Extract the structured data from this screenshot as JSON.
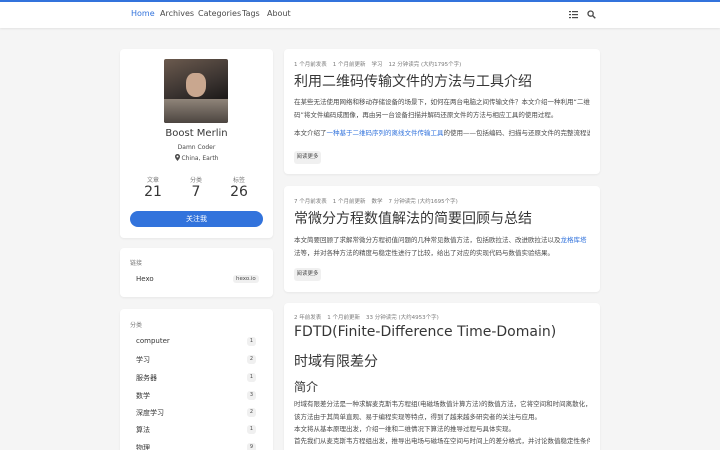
{
  "nav": {
    "items": [
      "Home",
      "Archives",
      "Categories",
      "Tags",
      "About"
    ],
    "icons": {
      "toc": "list-icon",
      "search": "search-icon"
    },
    "accent": "#3273dc"
  },
  "profile": {
    "name": "Boost Merlin",
    "tagline": "Damn Coder",
    "location": "China, Earth",
    "stats": [
      {
        "label": "文章",
        "value": "21"
      },
      {
        "label": "分类",
        "value": "7"
      },
      {
        "label": "标签",
        "value": "26"
      }
    ],
    "follow_label": "关注我"
  },
  "links": {
    "heading": "链接",
    "items": [
      {
        "name": "Hexo",
        "url_label": "hexo.io"
      }
    ]
  },
  "categories": {
    "heading": "分类",
    "items": [
      {
        "name": "computer",
        "count": "1"
      },
      {
        "name": "学习",
        "count": "2"
      },
      {
        "name": "服务器",
        "count": "1"
      },
      {
        "name": "数学",
        "count": "3"
      },
      {
        "name": "深度学习",
        "count": "2"
      },
      {
        "name": "算法",
        "count": "1"
      },
      {
        "name": "物理",
        "count": "9"
      }
    ]
  },
  "posts": [
    {
      "meta": [
        "1 个月前发表",
        "1 个月前更新",
        "学习",
        "12 分钟读完 (大约1795个字)"
      ],
      "title": "利用二维码传输文件的方法与工具介绍",
      "para1": "在某些无法使用网络和移动存储设备的场景下，如何在两台电脑之间传输文件？本文介绍一种利用“二维码”将文件编码成图像，再由另一台设备扫描并解码还原文件的方法与相应工具的使用过程。",
      "para2_pre": "本文介绍了",
      "para2_link": "一种基于二维码序列的离线文件传输工具",
      "para2_post": "的使用——包括编码、扫描与还原文件的完整流程说明。",
      "more": "阅读更多"
    },
    {
      "meta": [
        "7 个月前发表",
        "1 个月前更新",
        "数学",
        "7 分钟读完 (大约1695个字)"
      ],
      "title": "常微分方程数值解法的简要回顾与总结",
      "para1_pre": "本文简要回顾了求解常微分方程初值问题的几种常见数值方法，包括欧拉法、改进欧拉法以及",
      "para1_link": "龙格库塔",
      "para1_post": "法等，并对各种方法的精度与稳定性进行了比较，给出了对应的实现代码与数值实验结果。",
      "more": "阅读更多"
    },
    {
      "meta": [
        "2 年前发表",
        "1 个月前更新",
        "33 分钟读完 (大约4953个字)"
      ],
      "title": "FDTD(Finite-Difference Time-Domain)",
      "h1": "时域有限差分",
      "h2": "简介",
      "lines": [
        "时域有限差分法是一种求解麦克斯韦方程组(电磁场数值计算方法)的数值方法，它将空间和时间离散化，用差分代替微分，直接在时域中对电磁场进行迭代求解，广泛应用于各类电磁问题。",
        "该方法由于其简单直观、易于编程实现等特点，得到了越来越多研究者的关注与应用。",
        "本文将从基本原理出发，介绍一维和二维情况下算法的推导过程与具体实现。",
        "首先我们从麦克斯韦方程组出发，推导出电场与磁场在空间与时间上的差分格式，并讨论数值稳定性条件与边界条件的设置方法，最后给出完整的计算示例。"
      ]
    }
  ]
}
